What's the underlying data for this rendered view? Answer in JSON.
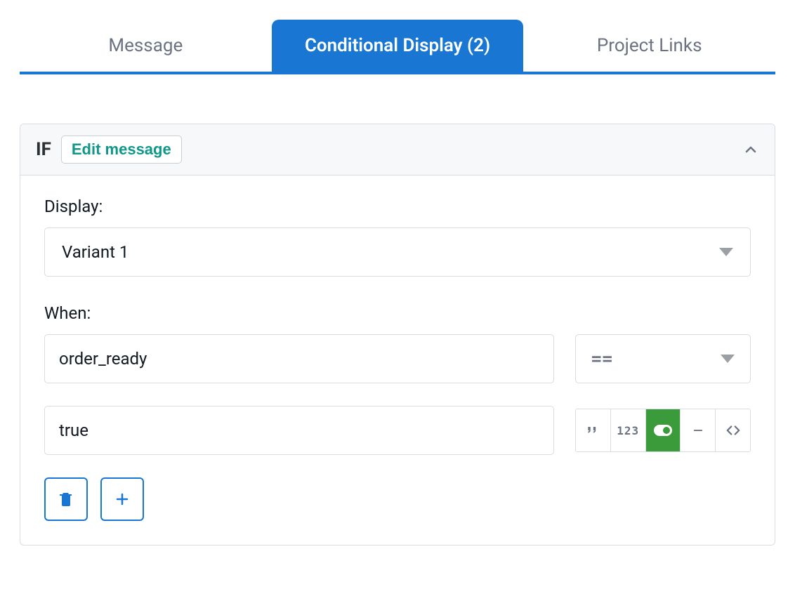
{
  "tabs": {
    "message": "Message",
    "conditional": "Conditional Display (2)",
    "project_links": "Project Links"
  },
  "panel": {
    "if_label": "IF",
    "edit_button": "Edit message",
    "display_label": "Display:",
    "display_value": "Variant 1",
    "when_label": "When:",
    "condition_field": "order_ready",
    "operator": "==",
    "condition_value": "true",
    "type_buttons": {
      "num": "123"
    }
  }
}
